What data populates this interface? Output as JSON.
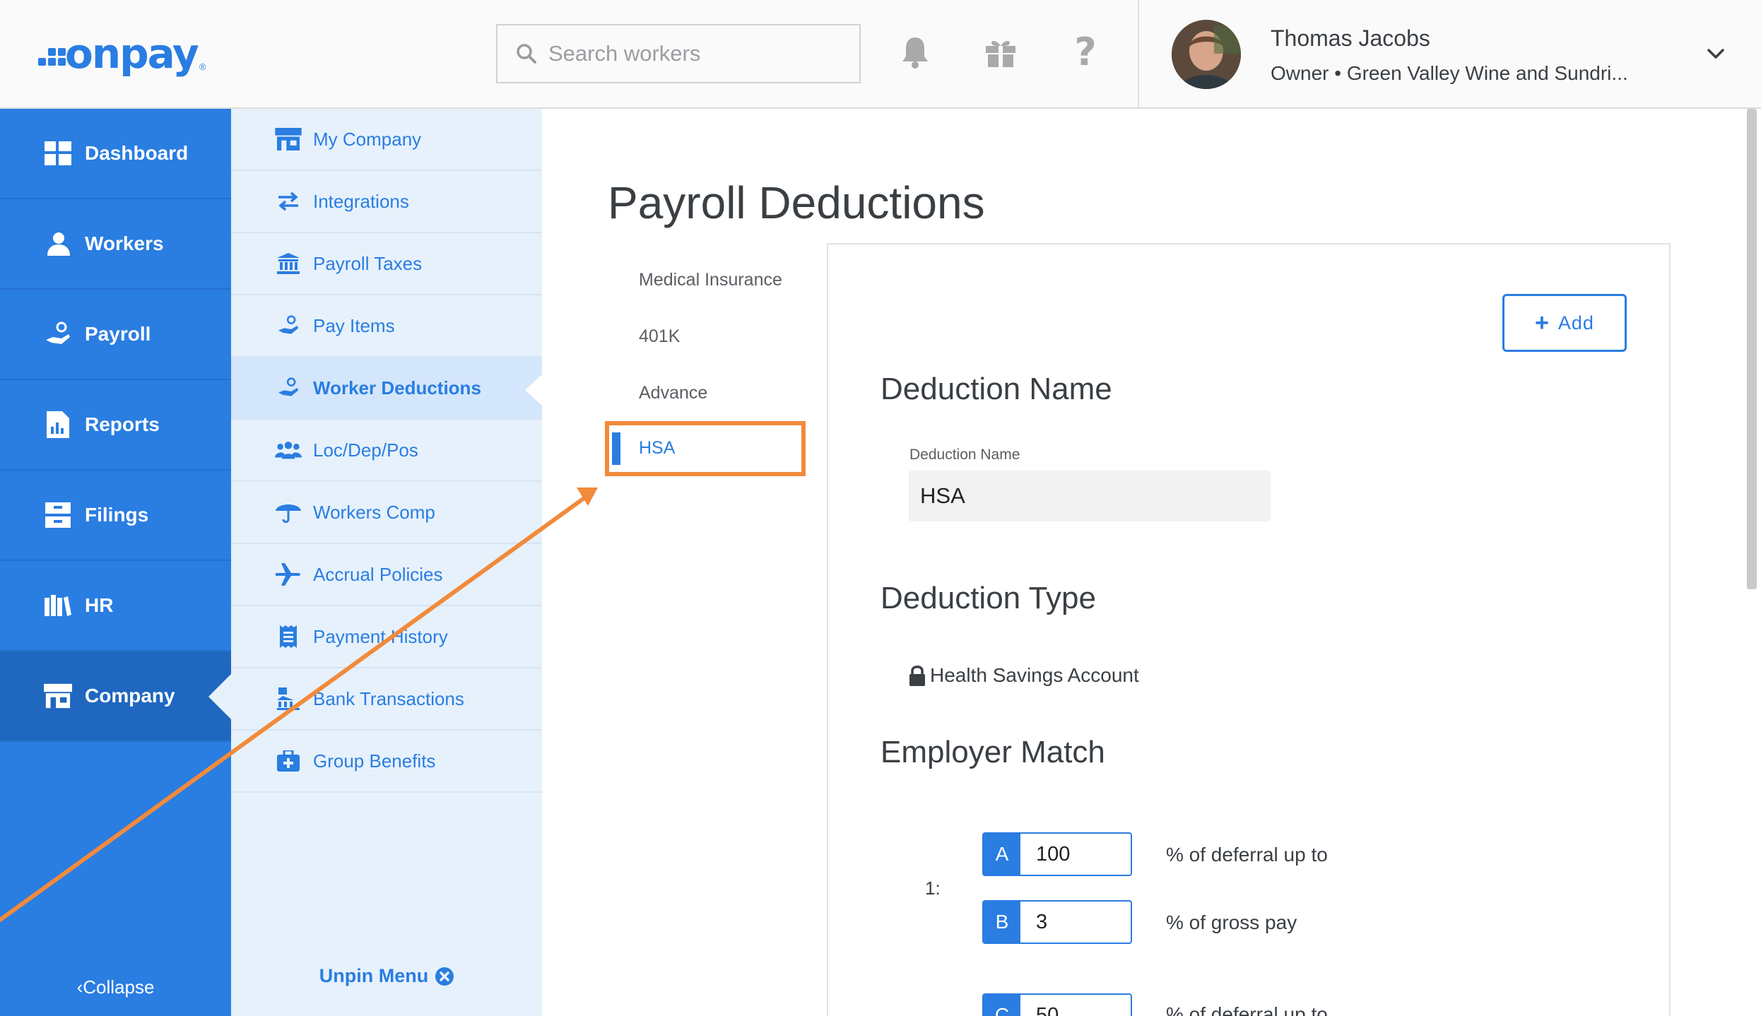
{
  "brand": {
    "logo_text": "onpay",
    "logo_reg": "®",
    "accent": "#2a7de1"
  },
  "header": {
    "search_placeholder": "Search workers",
    "icons": [
      "bell-icon",
      "gift-icon",
      "help-icon"
    ],
    "help_glyph": "?",
    "user": {
      "name": "Thomas Jacobs",
      "role": "Owner • Green Valley Wine and Sundri..."
    }
  },
  "nav": {
    "items": [
      {
        "label": "Dashboard",
        "icon": "dashboard-icon"
      },
      {
        "label": "Workers",
        "icon": "workers-icon"
      },
      {
        "label": "Payroll",
        "icon": "payroll-icon"
      },
      {
        "label": "Reports",
        "icon": "reports-icon"
      },
      {
        "label": "Filings",
        "icon": "filings-icon"
      },
      {
        "label": "HR",
        "icon": "hr-icon"
      },
      {
        "label": "Company",
        "icon": "company-icon",
        "active": true
      }
    ],
    "collapse_label": "Collapse"
  },
  "subnav": {
    "items": [
      {
        "label": "My Company",
        "icon": "store-icon"
      },
      {
        "label": "Integrations",
        "icon": "swap-icon"
      },
      {
        "label": "Payroll Taxes",
        "icon": "bank-icon"
      },
      {
        "label": "Pay Items",
        "icon": "hand-coin-icon"
      },
      {
        "label": "Worker Deductions",
        "icon": "hand-coin-icon",
        "active": true
      },
      {
        "label": "Loc/Dep/Pos",
        "icon": "users-icon"
      },
      {
        "label": "Workers Comp",
        "icon": "umbrella-icon"
      },
      {
        "label": "Accrual Policies",
        "icon": "plane-icon"
      },
      {
        "label": "Payment History",
        "icon": "receipt-icon"
      },
      {
        "label": "Bank Transactions",
        "icon": "bank-transactions-icon"
      },
      {
        "label": "Group Benefits",
        "icon": "medkit-icon"
      }
    ],
    "unpin_label": "Unpin Menu"
  },
  "main": {
    "title": "Payroll Deductions",
    "deductions": [
      "Medical Insurance",
      "401K",
      "Advance",
      "HSA"
    ],
    "selected_deduction": "HSA",
    "add_label": "Add",
    "deduction_name_heading": "Deduction Name",
    "deduction_name_field_label": "Deduction Name",
    "deduction_name_value": "HSA",
    "deduction_type_heading": "Deduction Type",
    "deduction_type_value": "Health Savings Account",
    "employer_match_heading": "Employer Match",
    "match_row_label": "1:",
    "match_fields": [
      {
        "key": "A",
        "value": "100",
        "desc": "% of deferral up to"
      },
      {
        "key": "B",
        "value": "3",
        "desc": "% of gross pay"
      },
      {
        "key": "C",
        "value": "50",
        "desc": "% of deferral up to"
      }
    ]
  },
  "annotation": {
    "highlight_color": "#f28a3b"
  }
}
